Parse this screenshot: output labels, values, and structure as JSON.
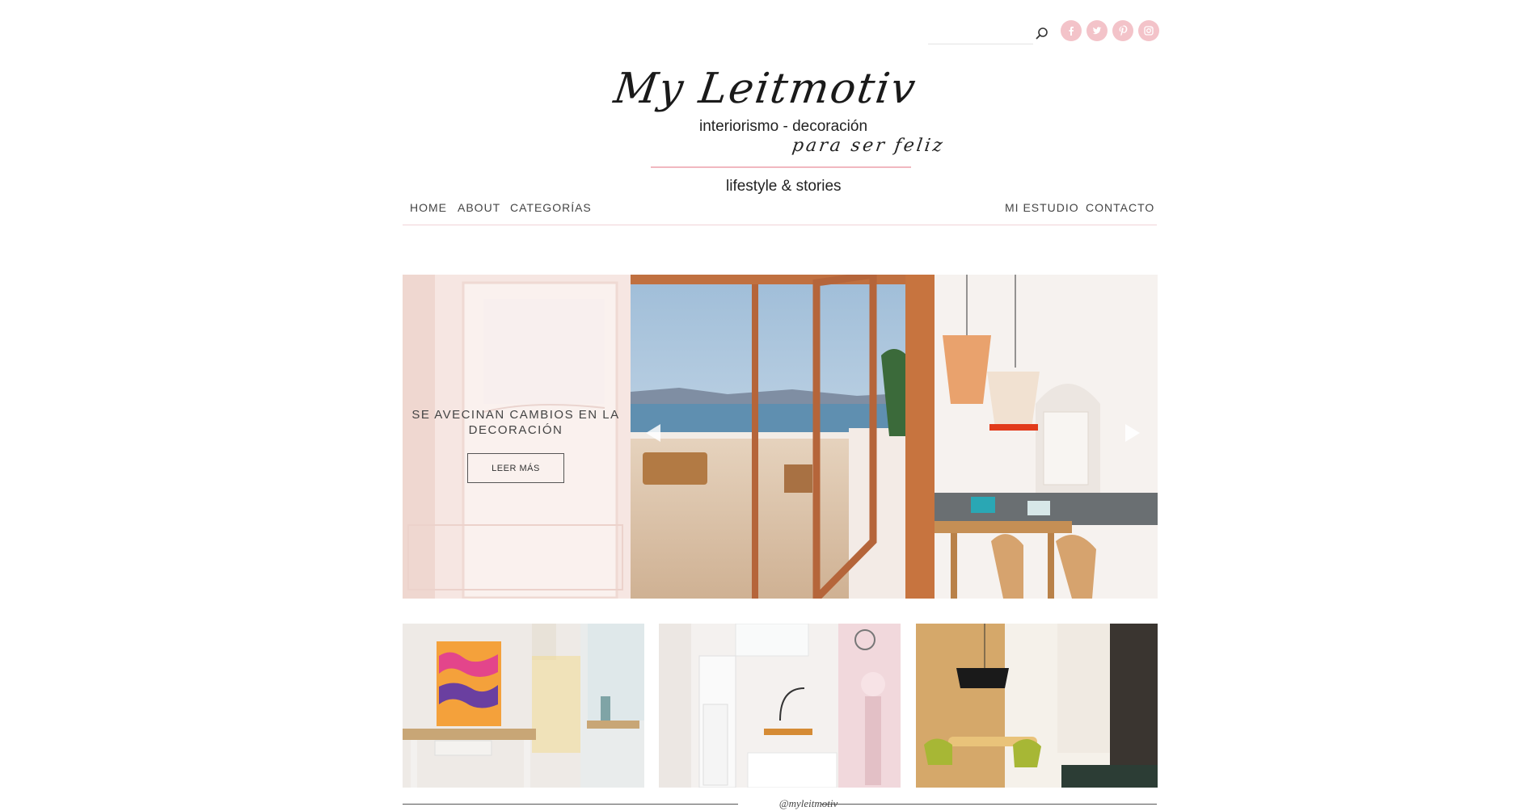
{
  "header": {
    "search": {
      "placeholder": "",
      "value": ""
    },
    "social": [
      {
        "icon": "facebook-icon",
        "label": "f"
      },
      {
        "icon": "twitter-icon",
        "label": "t"
      },
      {
        "icon": "pinterest-icon",
        "label": "p"
      },
      {
        "icon": "instagram-icon",
        "label": "ig"
      }
    ],
    "social_color": "#f3c3c9"
  },
  "logo": {
    "script": "My Leitmotiv",
    "subtitle": "interiorismo - decoración",
    "tagline": "para ser feliz",
    "lifestyle": "lifestyle & stories"
  },
  "nav": {
    "left": [
      "HOME",
      "ABOUT",
      "CATEGORÍAS"
    ],
    "right": [
      "MI ESTUDIO",
      "CONTACTO"
    ]
  },
  "slider": {
    "title": "SE AVECINAN CAMBIOS EN LA DECORACIÓN",
    "button": "LEER MÁS"
  },
  "footer": {
    "instagram_handle": "@myleitmotiv"
  },
  "colors": {
    "accent_pink": "#f1b8c0",
    "overlay": "#f7e8e6"
  }
}
